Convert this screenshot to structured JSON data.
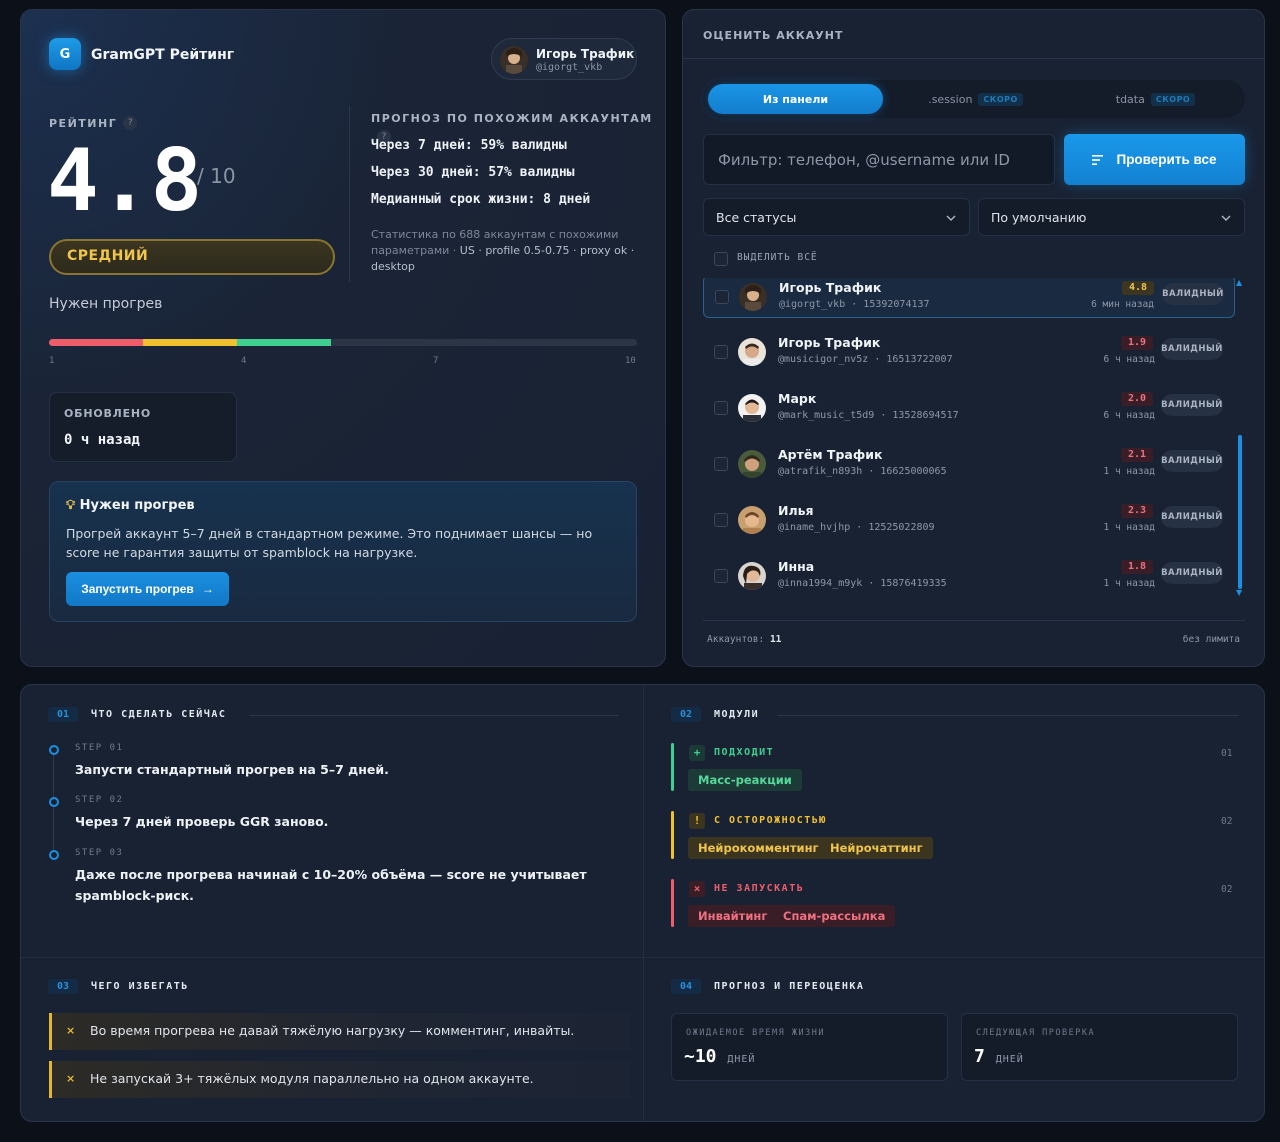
{
  "app": {
    "logo_letter": "G",
    "title": "GramGPT Рейтинг"
  },
  "user": {
    "name": "Игорь Трафик",
    "handle": "@igorgt_vkb"
  },
  "rating": {
    "label": "РЕЙТИНГ",
    "help": "?",
    "value": "4.8",
    "max": "/ 10",
    "level": "СРЕДНИЙ",
    "note": "Нужен прогрев",
    "scale_ticks": [
      "1",
      "4",
      "7",
      "10"
    ],
    "progress": 0.48,
    "segment_colors": [
      "#ef5d6a",
      "#f0c02e",
      "#3fcf8e"
    ]
  },
  "forecast": {
    "title": "ПРОГНОЗ ПО ПОХОЖИМ АККАУНТАМ",
    "help": "?",
    "lines": [
      "Через 7 дней: 59% валидны",
      "Через 30 дней: 57% валидны",
      "Медианный срок жизни: 8 дней"
    ],
    "note_prefix": "Статистика по 688 аккаунтам с похожими параметрами · ",
    "note_params": "US · profile 0.5-0.75 · proxy ok",
    "note_suffix": " · desktop"
  },
  "updated": {
    "label": "ОБНОВЛЕНО",
    "value": "0 ч назад"
  },
  "tip": {
    "icon": "lightbulb-icon",
    "title": "Нужен прогрев",
    "text": "Прогрей аккаунт 5–7 дней в стандартном режиме. Это поднимает шансы — но score не гарантия защиты от spamblock на нагрузке.",
    "button": "Запустить прогрев"
  },
  "evaluate": {
    "title": "ОЦЕНИТЬ АККАУНТ",
    "tabs": [
      {
        "label": "Из панели",
        "soon": ""
      },
      {
        "label": ".session",
        "soon": "СКОРО"
      },
      {
        "label": "tdata",
        "soon": "СКОРО"
      }
    ],
    "filter_placeholder": "Фильтр: телефон, @username или ID",
    "check_all": "Проверить все",
    "status_select": "Все статусы",
    "sort_select": "По умолчанию",
    "select_all": "ВЫДЕЛИТЬ ВСЁ",
    "accounts": [
      {
        "name": "Игорь Трафик",
        "handle": "@igorgt_vkb",
        "id": "15392074137",
        "score": "4.8",
        "time": "6 мин назад",
        "status": "ВАЛИДНЫЙ"
      },
      {
        "name": "Игорь Трафик",
        "handle": "@musicigor_nv5z",
        "id": "16513722007",
        "score": "1.9",
        "time": "6 ч назад",
        "status": "ВАЛИДНЫЙ"
      },
      {
        "name": "Марк",
        "handle": "@mark_music_t5d9",
        "id": "13528694517",
        "score": "2.0",
        "time": "6 ч назад",
        "status": "ВАЛИДНЫЙ"
      },
      {
        "name": "Артём Трафик",
        "handle": "@atrafik_n893h",
        "id": "16625000065",
        "score": "2.1",
        "time": "1 ч назад",
        "status": "ВАЛИДНЫЙ"
      },
      {
        "name": "Илья",
        "handle": "@iname_hvjhp",
        "id": "12525022809",
        "score": "2.3",
        "time": "1 ч назад",
        "status": "ВАЛИДНЫЙ"
      },
      {
        "name": "Инна",
        "handle": "@inna1994_m9yk",
        "id": "15876419335",
        "score": "1.8",
        "time": "1 ч назад",
        "status": "ВАЛИДНЫЙ"
      }
    ],
    "count_label": "Аккаунтов:",
    "count": "11",
    "limit": "без лимита"
  },
  "todo": {
    "num": "01",
    "title": "ЧТО СДЕЛАТЬ СЕЙЧАС",
    "steps": [
      {
        "cap": "STEP 01",
        "text": "Запусти стандартный прогрев на 5–7 дней."
      },
      {
        "cap": "STEP 02",
        "text": "Через 7 дней проверь GGR заново."
      },
      {
        "cap": "STEP 03",
        "text": "Даже после прогрева начинай с 10–20% объёма — score не учитывает spamblock-риск."
      }
    ]
  },
  "modules": {
    "num": "02",
    "title": "МОДУЛИ",
    "groups": [
      {
        "icon": "+",
        "title": "ПОДХОДИТ",
        "num": "01",
        "color": "#3fcf8e",
        "chips": [
          "Масс-реакции"
        ]
      },
      {
        "icon": "!",
        "title": "С ОСТОРОЖНОСТЬЮ",
        "num": "02",
        "color": "#f0c02e",
        "chips": [
          "Нейрокомментинг",
          "Нейрочаттинг"
        ]
      },
      {
        "icon": "×",
        "title": "НЕ ЗАПУСКАТЬ",
        "num": "02",
        "color": "#ef5d6a",
        "chips": [
          "Инвайтинг",
          "Спам-рассылка"
        ]
      }
    ]
  },
  "avoid": {
    "num": "03",
    "title": "ЧЕГО ИЗБЕГАТЬ",
    "items": [
      "Во время прогрева не давай тяжёлую нагрузку — комментинг, инвайты.",
      "Не запускай 3+ тяжёлых модуля параллельно на одном аккаунте."
    ]
  },
  "reassess": {
    "num": "04",
    "title": "ПРОГНОЗ И ПЕРЕОЦЕНКА",
    "cards": [
      {
        "label": "ОЖИДАЕМОЕ ВРЕМЯ ЖИЗНИ",
        "value": "~10",
        "unit": "ДНЕЙ"
      },
      {
        "label": "СЛЕДУЮЩАЯ ПРОВЕРКА",
        "value": "7",
        "unit": "ДНЕЙ"
      }
    ]
  }
}
